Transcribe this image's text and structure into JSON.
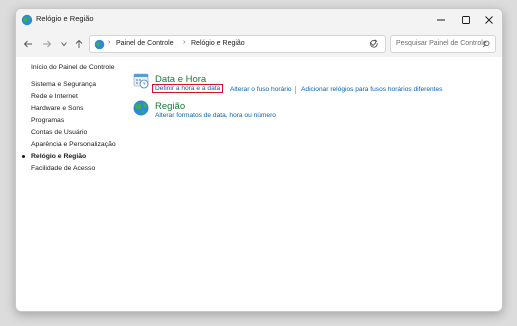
{
  "window": {
    "title": "Relógio e Região"
  },
  "nav": {
    "breadcrumbs": [
      "Painel de Controle",
      "Relógio e Região"
    ],
    "search_placeholder": "Pesquisar Painel de Controle"
  },
  "sidebar": {
    "home": "Início do Painel de Controle",
    "items": [
      {
        "label": "Sistema e Segurança",
        "current": false
      },
      {
        "label": "Rede e Internet",
        "current": false
      },
      {
        "label": "Hardware e Sons",
        "current": false
      },
      {
        "label": "Programas",
        "current": false
      },
      {
        "label": "Contas de Usuário",
        "current": false
      },
      {
        "label": "Aparência e Personalização",
        "current": false
      },
      {
        "label": "Relógio e Região",
        "current": true
      },
      {
        "label": "Facilidade de Acesso",
        "current": false
      }
    ]
  },
  "categories": [
    {
      "title": "Data e Hora",
      "icon": "date-time-icon",
      "links": [
        "Definir a hora e a data",
        "Alterar o fuso horário",
        "Adicionar relógios para fusos horários diferentes"
      ]
    },
    {
      "title": "Região",
      "icon": "globe-icon",
      "links": [
        "Alterar formatos de data, hora ou número"
      ]
    }
  ],
  "colors": {
    "link": "#0b62b5",
    "category_title": "#1a7a3c",
    "highlight_box": "#d3122b"
  }
}
